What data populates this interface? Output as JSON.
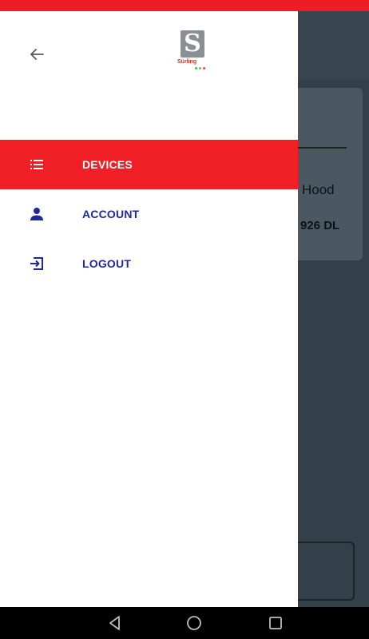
{
  "colors": {
    "status_bar": "#ee1c24",
    "accent": "#f01f26",
    "menu_text": "#1e2a9b",
    "drawer_bg": "#ffffff",
    "scrim": "#324149"
  },
  "drawer": {
    "back_icon": "arrow-left-icon",
    "logo_text": "Sürling",
    "menu": [
      {
        "label": "DEVICES",
        "icon": "list-icon",
        "active": true
      },
      {
        "label": "ACCOUNT",
        "icon": "person-icon",
        "active": false
      },
      {
        "label": "LOGOUT",
        "icon": "logout-icon",
        "active": false
      }
    ]
  },
  "background": {
    "card_title": "Hood",
    "card_subtitle": "926 DL"
  },
  "nav_bar": {
    "back": "nav-back-icon",
    "home": "nav-home-icon",
    "recents": "nav-recents-icon"
  }
}
